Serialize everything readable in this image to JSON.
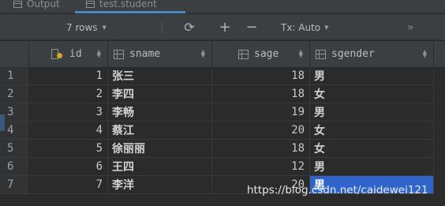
{
  "tabs": [
    {
      "label": "Output"
    },
    {
      "label": "test.student"
    }
  ],
  "toolbar": {
    "rows_label": "7 rows",
    "tx_label": "Tx: Auto"
  },
  "columns": [
    {
      "name": "id"
    },
    {
      "name": "sname"
    },
    {
      "name": "sage"
    },
    {
      "name": "sgender"
    }
  ],
  "rows": [
    {
      "num": "1",
      "id": "1",
      "sname": "张三",
      "sage": "18",
      "sgender": "男"
    },
    {
      "num": "2",
      "id": "2",
      "sname": "李四",
      "sage": "18",
      "sgender": "女"
    },
    {
      "num": "3",
      "id": "3",
      "sname": "李畅",
      "sage": "19",
      "sgender": "男"
    },
    {
      "num": "4",
      "id": "4",
      "sname": "蔡江",
      "sage": "20",
      "sgender": "女"
    },
    {
      "num": "5",
      "id": "5",
      "sname": "徐丽丽",
      "sage": "18",
      "sgender": "女"
    },
    {
      "num": "6",
      "id": "6",
      "sname": "王四",
      "sage": "12",
      "sgender": "男"
    },
    {
      "num": "7",
      "id": "7",
      "sname": "李洋",
      "sage": "20",
      "sgender": "男"
    }
  ],
  "selected_cell": {
    "row": 7,
    "column": "sgender"
  },
  "watermark": "https://blog.csdn.net/caidewei121",
  "colors": {
    "background": "#2b2b2b",
    "toolbar": "#3c3f41",
    "selection": "#2f65ca",
    "tab_underline": "#4a88c7",
    "key_icon": "#d4a72c"
  }
}
